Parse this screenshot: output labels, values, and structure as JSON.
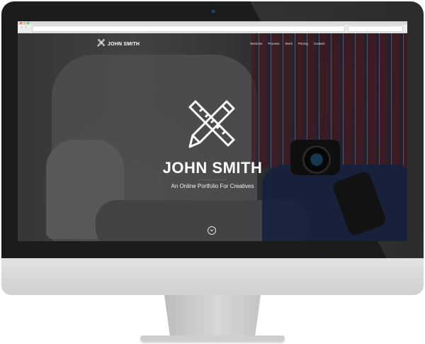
{
  "site": {
    "brand": "JOHN SMITH",
    "menu": [
      "Services",
      "Process",
      "Work",
      "Pricing",
      "Contact"
    ],
    "hero_title": "JOHN SMITH",
    "tagline": "An Online Portfolio For Creatives",
    "icons": {
      "logo": "pencil-ruler-cross-icon",
      "scroll": "chevron-down-circle-icon"
    }
  },
  "colors": {
    "accent": "#c0392b",
    "bezel": "#1c1c1c",
    "text": "#ffffff"
  }
}
